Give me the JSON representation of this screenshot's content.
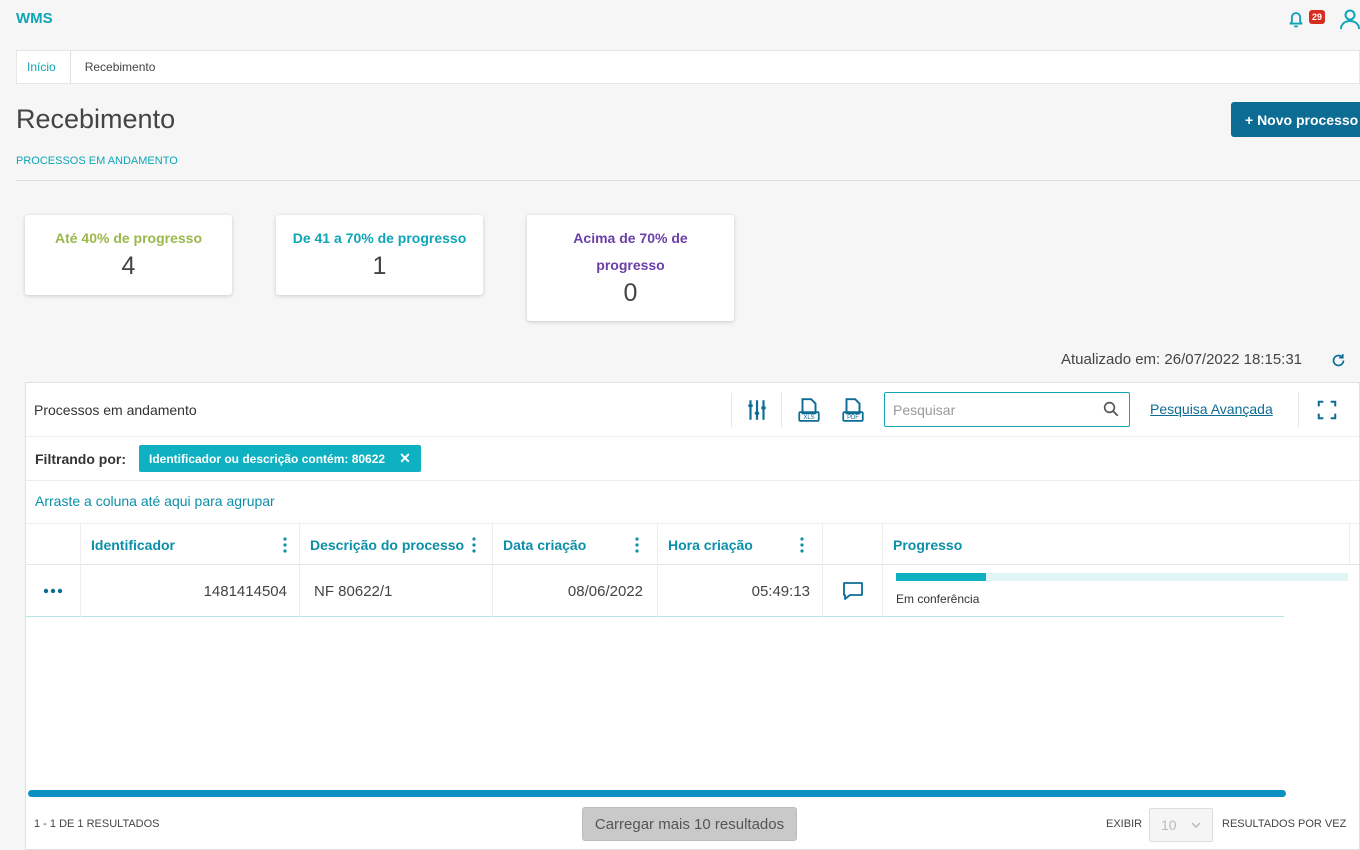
{
  "app": {
    "title": "WMS",
    "notification_count": "29"
  },
  "breadcrumb": {
    "home": "Início",
    "current": "Recebimento"
  },
  "page": {
    "title": "Recebimento",
    "subtitle": "PROCESSOS EM ANDAMENTO",
    "new_button": "+ Novo processo"
  },
  "cards": [
    {
      "label": "Até 40% de progresso",
      "value": "4",
      "color": "#9bb84a"
    },
    {
      "label": "De 41 a 70% de progresso",
      "value": "1",
      "color": "#0ea5b7"
    },
    {
      "label": "Acima de 70% de progresso",
      "value": "0",
      "color": "#6b3fa8"
    }
  ],
  "updated": "Atualizado em: 26/07/2022 18:15:31",
  "panel": {
    "title": "Processos em andamento",
    "search_placeholder": "Pesquisar",
    "advanced_search": "Pesquisa Avançada",
    "filter_label": "Filtrando por:",
    "filter_chip": "Identificador ou descrição contém: 80622",
    "group_hint": "Arraste a coluna até aqui para agrupar"
  },
  "table": {
    "columns": [
      "Identificador",
      "Descrição do processo",
      "Data criação",
      "Hora criação",
      "Progresso"
    ],
    "rows": [
      {
        "identificador": "1481414504",
        "descricao": "NF 80622/1",
        "data": "08/06/2022",
        "hora": "05:49:13",
        "progresso_label": "Em conferência",
        "progresso_fraction": 0.2
      }
    ]
  },
  "footer": {
    "count": "1 - 1 DE 1 RESULTADOS",
    "load_more": "Carregar mais 10 resultados",
    "exibir": "EXIBIR",
    "page_size": "10",
    "per_page": "RESULTADOS POR VEZ"
  },
  "colors": {
    "accent": "#0ea5b7",
    "primary": "#0c6c94"
  }
}
